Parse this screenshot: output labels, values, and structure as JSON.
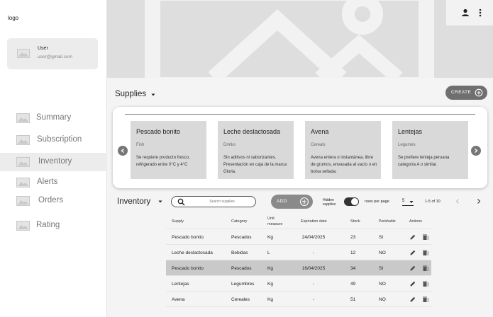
{
  "sidebar": {
    "logo": "logo",
    "user": {
      "name": "User",
      "email": "user@gmail.com"
    },
    "items": [
      {
        "label": "Summary",
        "active": false
      },
      {
        "label": "Subscription",
        "active": false
      },
      {
        "label": "Inventory",
        "active": true
      },
      {
        "label": "Alerts",
        "active": false
      },
      {
        "label": "Orders",
        "active": false
      },
      {
        "label": "Rating",
        "active": false
      }
    ]
  },
  "header": {
    "icons": [
      "account-icon",
      "more-vertical-icon"
    ]
  },
  "supplies": {
    "title": "Supplies",
    "create_label": "CREATE",
    "cards": [
      {
        "title": "Pescado bonito",
        "category": "Fish",
        "description": "Se requiere producto fresco, refrigerado entre 0°C y 4°C"
      },
      {
        "title": "Leche deslactosada",
        "category": "Drinks",
        "description": "Sin aditivos ni saborizantes. Presentación en caja de la marca Gloria."
      },
      {
        "title": "Avena",
        "category": "Cereals",
        "description": "Avena entera o instantánea, libre de grumos, envasada al vacío o en bolsa sellada."
      },
      {
        "title": "Lentejas",
        "category": "Legumes",
        "description": "Se prefiere lenteja peruana categoría A o similar."
      }
    ]
  },
  "inventory": {
    "title": "Inventory",
    "search_placeholder": "Search supplies",
    "add_label": "ADD",
    "hidden_label": "Hidden supplies",
    "hidden_toggle_on": true,
    "rows_per_page_label": "rows per page",
    "rows_per_page": "5",
    "range": "1-5 of 10",
    "columns": [
      "Supply",
      "Category",
      "Unit measure",
      "Expiration date",
      "Stock",
      "Perishable",
      "Actions"
    ],
    "rows": [
      {
        "supply": "Pescado bonito",
        "category": "Pescados",
        "unit": "Kg",
        "expiration": "24/04/2025",
        "stock": "23",
        "perishable": "SI",
        "selected": false
      },
      {
        "supply": "Leche deslactosada",
        "category": "Bebidas",
        "unit": "L",
        "expiration": "-",
        "stock": "12",
        "perishable": "NO",
        "selected": false
      },
      {
        "supply": "Pescado bonito",
        "category": "Pescados",
        "unit": "Kg",
        "expiration": "16/04/2025",
        "stock": "34",
        "perishable": "SI",
        "selected": true
      },
      {
        "supply": "Lentejas",
        "category": "Legumbres",
        "unit": "Kg",
        "expiration": "-",
        "stock": "49",
        "perishable": "NO",
        "selected": false
      },
      {
        "supply": "Avena",
        "category": "Cereales",
        "unit": "Kg",
        "expiration": "-",
        "stock": "51",
        "perishable": "NO",
        "selected": false
      }
    ]
  },
  "colors": {
    "accent": "#6f6f6f",
    "selected_row": "#c9c9c9",
    "sidebar_active": "#ececec"
  }
}
